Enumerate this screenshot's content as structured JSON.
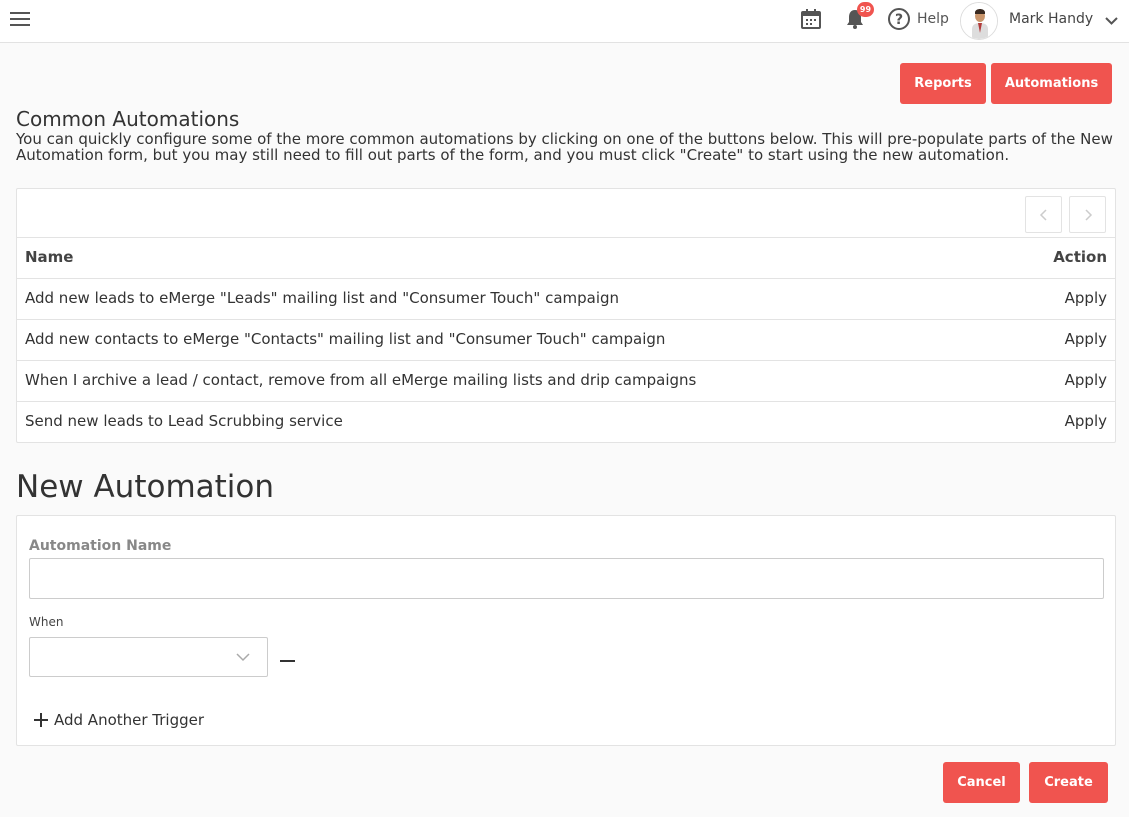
{
  "header": {
    "notification_count": "99",
    "help_label": "Help",
    "user_name": "Mark Handy",
    "icons": [
      "menu-icon",
      "calendar-icon",
      "bell-icon",
      "help-icon",
      "chevron-down-icon"
    ]
  },
  "actions": {
    "reports_label": "Reports",
    "automations_label": "Automations"
  },
  "common": {
    "title": "Common Automations",
    "description": "You can quickly configure some of the more common automations by clicking on one of the buttons below. This will pre-populate parts of the New Automation form, but you may still need to fill out parts of the form, and you must click \"Create\" to start using the new automation.",
    "table": {
      "columns": [
        "Name",
        "Action"
      ],
      "rows": [
        {
          "name": "Add new leads to eMerge \"Leads\" mailing list and \"Consumer Touch\" campaign",
          "action": "Apply"
        },
        {
          "name": "Add new contacts to eMerge \"Contacts\" mailing list and \"Consumer Touch\" campaign",
          "action": "Apply"
        },
        {
          "name": "When I archive a lead / contact, remove from all eMerge mailing lists and drip campaigns",
          "action": "Apply"
        },
        {
          "name": "Send new leads to Lead Scrubbing service",
          "action": "Apply"
        }
      ]
    }
  },
  "new_automation": {
    "title": "New Automation",
    "name_label": "Automation Name",
    "name_value": "",
    "when_label": "When",
    "when_value": "",
    "add_trigger_label": "Add Another Trigger"
  },
  "footer": {
    "cancel_label": "Cancel",
    "create_label": "Create"
  },
  "colors": {
    "accent": "#f0544f",
    "background": "#fafafa"
  }
}
